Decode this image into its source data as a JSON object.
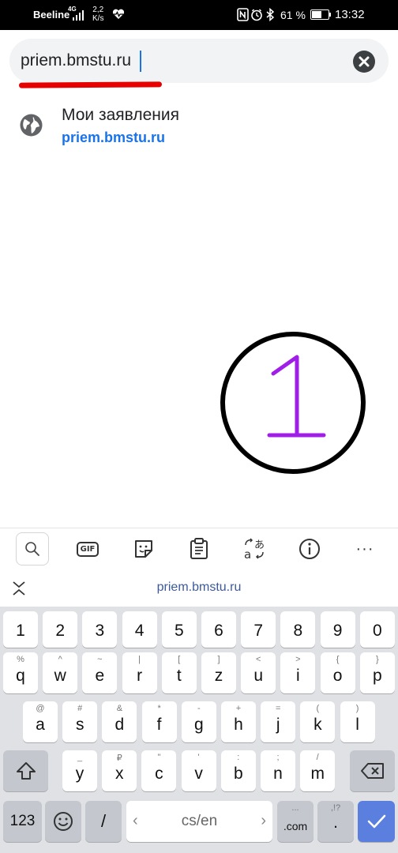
{
  "status_bar": {
    "carrier": "Beeline",
    "network": "4G",
    "speed_value": "2,2",
    "speed_unit": "K/s",
    "battery_percent": "61 %",
    "battery_level": 0.61,
    "time": "13:32"
  },
  "browser": {
    "url_value": "priem.bmstu.ru",
    "clear_icon": "close-circle-icon"
  },
  "suggestion": {
    "title": "Мои заявления",
    "url": "priem.bmstu.ru",
    "icon": "globe-icon"
  },
  "annotation": {
    "text": "1",
    "circle_color": "#000000",
    "text_color": "#a11ee8",
    "underline_color": "#e60000"
  },
  "keyboard_toolbar": {
    "items": [
      "search-icon",
      "gif-icon",
      "sticker-icon",
      "clipboard-icon",
      "translate-icon",
      "info-icon",
      "more-icon"
    ],
    "gif_label": "GIF",
    "more_label": "···"
  },
  "keyboard_suggestion": {
    "text": "priem.bmstu.ru"
  },
  "keyboard": {
    "numbers": [
      "1",
      "2",
      "3",
      "4",
      "5",
      "6",
      "7",
      "8",
      "9",
      "0"
    ],
    "row1": [
      {
        "main": "q",
        "alt": "%"
      },
      {
        "main": "w",
        "alt": "^"
      },
      {
        "main": "e",
        "alt": "~"
      },
      {
        "main": "r",
        "alt": "|"
      },
      {
        "main": "t",
        "alt": "["
      },
      {
        "main": "z",
        "alt": "]"
      },
      {
        "main": "u",
        "alt": "<"
      },
      {
        "main": "i",
        "alt": ">"
      },
      {
        "main": "o",
        "alt": "{"
      },
      {
        "main": "p",
        "alt": "}"
      }
    ],
    "row2": [
      {
        "main": "a",
        "alt": "@"
      },
      {
        "main": "s",
        "alt": "#"
      },
      {
        "main": "d",
        "alt": "&"
      },
      {
        "main": "f",
        "alt": "*"
      },
      {
        "main": "g",
        "alt": "-"
      },
      {
        "main": "h",
        "alt": "+"
      },
      {
        "main": "j",
        "alt": "="
      },
      {
        "main": "k",
        "alt": "("
      },
      {
        "main": "l",
        "alt": ")"
      }
    ],
    "row3": [
      {
        "main": "y",
        "alt": "_"
      },
      {
        "main": "x",
        "alt": "₽"
      },
      {
        "main": "c",
        "alt": "\""
      },
      {
        "main": "v",
        "alt": "'"
      },
      {
        "main": "b",
        "alt": ":"
      },
      {
        "main": "n",
        "alt": ";"
      },
      {
        "main": "m",
        "alt": "/"
      }
    ],
    "mode_key": "123",
    "slash_key": "/",
    "space_label": "cs/en",
    "com_key": ".com",
    "com_alt": "...",
    "period_key": ".",
    "period_alt": ",!?",
    "shift_icon": "shift-icon",
    "backspace_icon": "backspace-icon",
    "emoji_icon": "emoji-icon",
    "enter_icon": "checkmark-icon",
    "enter_color": "#5b7fde"
  }
}
